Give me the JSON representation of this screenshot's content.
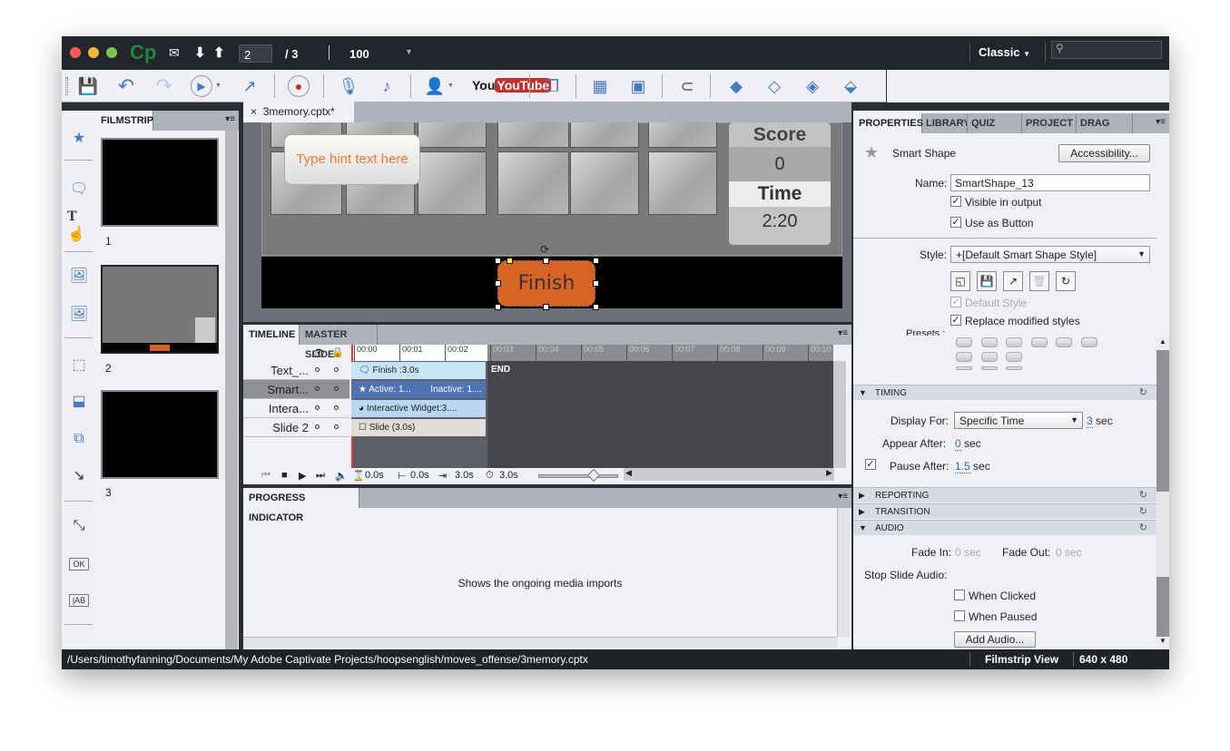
{
  "topbar": {
    "app_logo": "Cp",
    "current_slide": "2",
    "total_slides": "/ 3",
    "zoom": "100",
    "workspace": "Classic",
    "search_placeholder": ""
  },
  "toolbar": {
    "icons": [
      "save-icon",
      "undo-icon",
      "redo-icon",
      "play-icon",
      "publish-icon",
      "record-icon",
      "microphone-icon",
      "audio-note-icon",
      "user-icon",
      "youtube-icon",
      "assets-icon",
      "grid-icon",
      "snap-grid-icon",
      "magnet-icon",
      "bring-forward-icon",
      "send-backward-icon",
      "bring-front-icon",
      "send-back-icon"
    ],
    "youtube_label": "YouTube"
  },
  "filmstrip": {
    "tab": "FILMSTRIP",
    "slides": [
      {
        "number": "1"
      },
      {
        "number": "2"
      },
      {
        "number": "3"
      }
    ]
  },
  "document_tab": {
    "close": "×",
    "title": "3memory.cptx*"
  },
  "stage": {
    "hint_text": "Type hint text here",
    "score_label": "Score",
    "score_value": "0",
    "time_label": "Time",
    "time_value": "2:20",
    "finish_button": "Finish",
    "colors": {
      "finish": "#d96322",
      "hint": "#f07a35"
    }
  },
  "timeline": {
    "tabs": [
      "TIMELINE",
      "MASTER SLIDE"
    ],
    "ruler": [
      "00:00",
      "00:01",
      "00:02",
      "00:03",
      "00:04",
      "00:05",
      "00:06",
      "00:07",
      "00:08",
      "00:09",
      "00:10"
    ],
    "rows": [
      {
        "name": "Text_...",
        "bar": "Finish :3.0s"
      },
      {
        "name": "Smart...",
        "bar": "Active: 1...",
        "bar2": "Inactive: 1...."
      },
      {
        "name": "Intera...",
        "bar": "Interactive Widget:3...."
      },
      {
        "name": "Slide 2",
        "bar": "Slide (3.0s)"
      }
    ],
    "end_label": "END",
    "current_time": "0.0s",
    "start_time": "0.0s",
    "duration": "3.0s",
    "total_duration": "3.0s"
  },
  "progress": {
    "tab": "PROGRESS INDICATOR",
    "message": "Shows the ongoing media imports"
  },
  "properties": {
    "tabs": [
      "PROPERTIES",
      "LIBRARY",
      "QUIZ PROF",
      "PROJECT I",
      "DRAG AND"
    ],
    "object_type": "Smart Shape",
    "accessibility_button": "Accessibility...",
    "name_label": "Name:",
    "name_value": "SmartShape_13",
    "visible_in_output": "Visible in output",
    "use_as_button": "Use as Button",
    "style_label": "Style:",
    "style_value": "+[Default Smart Shape Style]",
    "default_style": "Default Style",
    "replace_modified": "Replace modified styles",
    "presets_label": "Presets :",
    "timing": {
      "header": "TIMING",
      "display_for_label": "Display For:",
      "display_for_value": "Specific Time",
      "display_time": "3",
      "sec": "sec",
      "appear_after_label": "Appear After:",
      "appear_after": "0",
      "pause_after_label": "Pause After:",
      "pause_after": "1.5"
    },
    "reporting": "REPORTING",
    "transition": "TRANSITION",
    "audio": {
      "header": "AUDIO",
      "fade_in_label": "Fade In:",
      "fade_in": "0 sec",
      "fade_out_label": "Fade Out:",
      "fade_out": "0 sec",
      "stop_label": "Stop Slide Audio:",
      "when_clicked": "When Clicked",
      "when_paused": "When Paused",
      "add_audio": "Add Audio..."
    }
  },
  "statusbar": {
    "path": "/Users/timothyfanning/Documents/My Adobe Captivate Projects/hoopsenglish/moves_offense/3memory.cptx",
    "view": "Filmstrip View",
    "resolution": "640 x 480"
  }
}
